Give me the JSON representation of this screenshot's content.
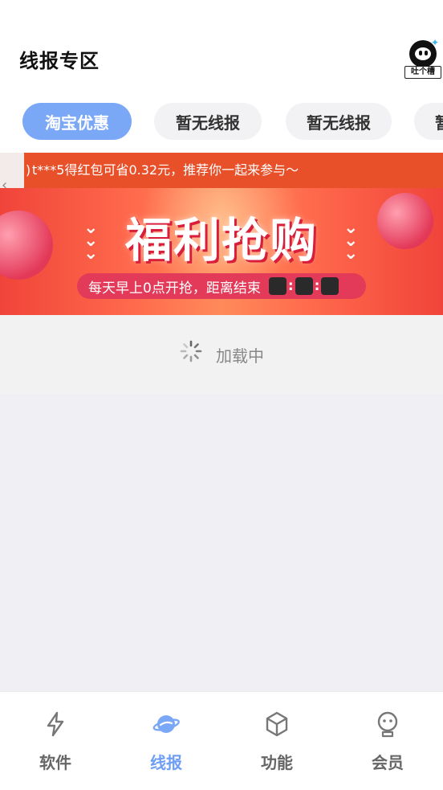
{
  "header": {
    "title": "线报专区",
    "feedback_label": "吐个槽"
  },
  "tabs": [
    {
      "label": "淘宝优惠",
      "active": true
    },
    {
      "label": "暂无线报",
      "active": false
    },
    {
      "label": "暂无线报",
      "active": false
    },
    {
      "label": "暂",
      "active": false
    }
  ],
  "notice": {
    "text": "t***5得红包可省0.32元，推荐你一起来参与～",
    "prefix": ")"
  },
  "banner": {
    "title": "福利抢购",
    "countdown_text": "每天早上0点开抢，距离结束",
    "countdown_separator": ":"
  },
  "loading": {
    "text": "加载中"
  },
  "bottom_nav": [
    {
      "label": "软件",
      "icon": "lightning-icon",
      "active": false
    },
    {
      "label": "线报",
      "icon": "planet-icon",
      "active": true
    },
    {
      "label": "功能",
      "icon": "cube-icon",
      "active": false
    },
    {
      "label": "会员",
      "icon": "robot-face-icon",
      "active": false
    }
  ],
  "colors": {
    "accent": "#7aa8f7",
    "nav_active": "#6e9ef5",
    "notice_bg": "#e8502a",
    "banner_pill": "#e23a58"
  }
}
